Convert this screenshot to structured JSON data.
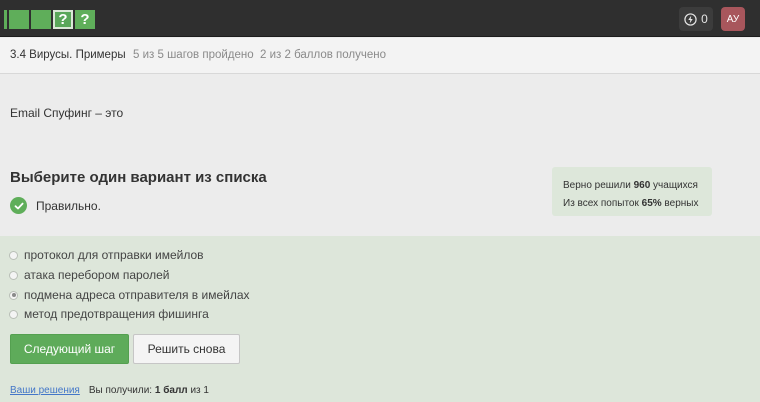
{
  "topbar": {
    "steps": [
      {
        "label": "",
        "state": "passed"
      },
      {
        "label": "",
        "state": "passed"
      },
      {
        "label": "",
        "state": "passed"
      },
      {
        "label": "?",
        "state": "current"
      },
      {
        "label": "?",
        "state": "passed"
      }
    ],
    "points": "0",
    "avatar_initials": "АУ"
  },
  "lesson_header": {
    "title": "3.4 Вирусы. Примеры",
    "progress": "5 из 5 шагов пройдено",
    "score": "2 из 2 баллов  получено"
  },
  "question": {
    "text": "Email Спуфинг – это",
    "choose_title": "Выберите один вариант из списка",
    "status": "Правильно."
  },
  "stats": {
    "line1_prefix": "Верно решили ",
    "line1_value": "960",
    "line1_suffix": " учащихся",
    "line2_prefix": "Из всех попыток ",
    "line2_value": "65%",
    "line2_suffix": " верных"
  },
  "options": [
    {
      "label": "протокол для отправки имейлов",
      "selected": false
    },
    {
      "label": "атака перебором паролей",
      "selected": false
    },
    {
      "label": "подмена адреса отправителя в имейлах",
      "selected": true
    },
    {
      "label": "метод предотвращения фишинга",
      "selected": false
    }
  ],
  "buttons": {
    "next": "Следующий шаг",
    "retry": "Решить снова"
  },
  "footer": {
    "solutions_link": "Ваши решения",
    "got_prefix": "Вы получили: ",
    "got_value": "1 балл",
    "got_mid": " из ",
    "got_total": "1"
  },
  "colors": {
    "accent_green": "#5fae5a",
    "answer_bg": "#dde6da",
    "topbar_bg": "#2f2f2f",
    "avatar_bg": "#a8565c"
  }
}
